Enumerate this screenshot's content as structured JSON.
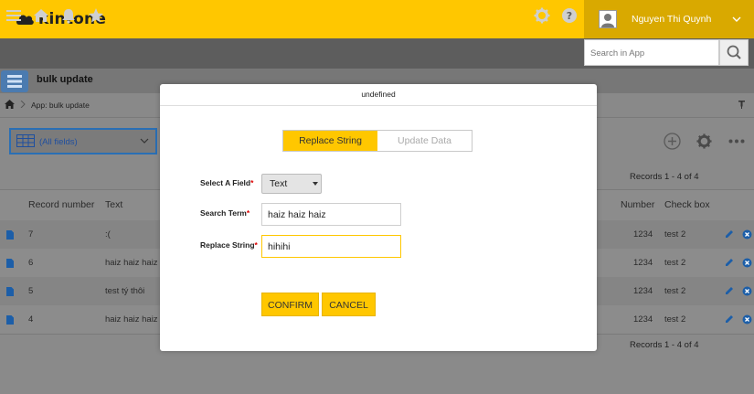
{
  "header": {
    "brand": "kintone",
    "user_name": "Nguyen Thi Quynh",
    "search_placeholder": "Search in App"
  },
  "app": {
    "name": "bulk update",
    "breadcrumb": "App: bulk update"
  },
  "view": {
    "selected": "(All fields)"
  },
  "records": {
    "range_top": "Records 1 - 4 of 4",
    "range_bottom": "Records 1 - 4 of 4",
    "columns": [
      "Record number",
      "Text",
      "Number",
      "Check box"
    ],
    "rows": [
      {
        "record_number": "7",
        "text": ":(",
        "number": "1234",
        "check_box": "test 2"
      },
      {
        "record_number": "6",
        "text": "haiz haiz haiz",
        "number": "1234",
        "check_box": "test 2"
      },
      {
        "record_number": "5",
        "text": "test tý thôi",
        "number": "1234",
        "check_box": "test 2"
      },
      {
        "record_number": "4",
        "text": "haiz haiz haiz",
        "number": "1234",
        "check_box": "test 2"
      }
    ]
  },
  "modal": {
    "title": "undefined",
    "tab_replace": "Replace String",
    "tab_update": "Update Data",
    "select_field_label": "Select A Field",
    "select_field_value": "Text",
    "search_term_label": "Search Term",
    "search_term_value": "haiz haiz haiz",
    "replace_string_label": "Replace String",
    "replace_string_value": "hihihi",
    "required_mark": "*",
    "confirm_label": "CONFIRM",
    "cancel_label": "CANCEL"
  },
  "colors": {
    "brand_yellow": "#ffc700",
    "toolbar_dark": "#5d5d5d",
    "link_blue": "#1f4f9f"
  }
}
